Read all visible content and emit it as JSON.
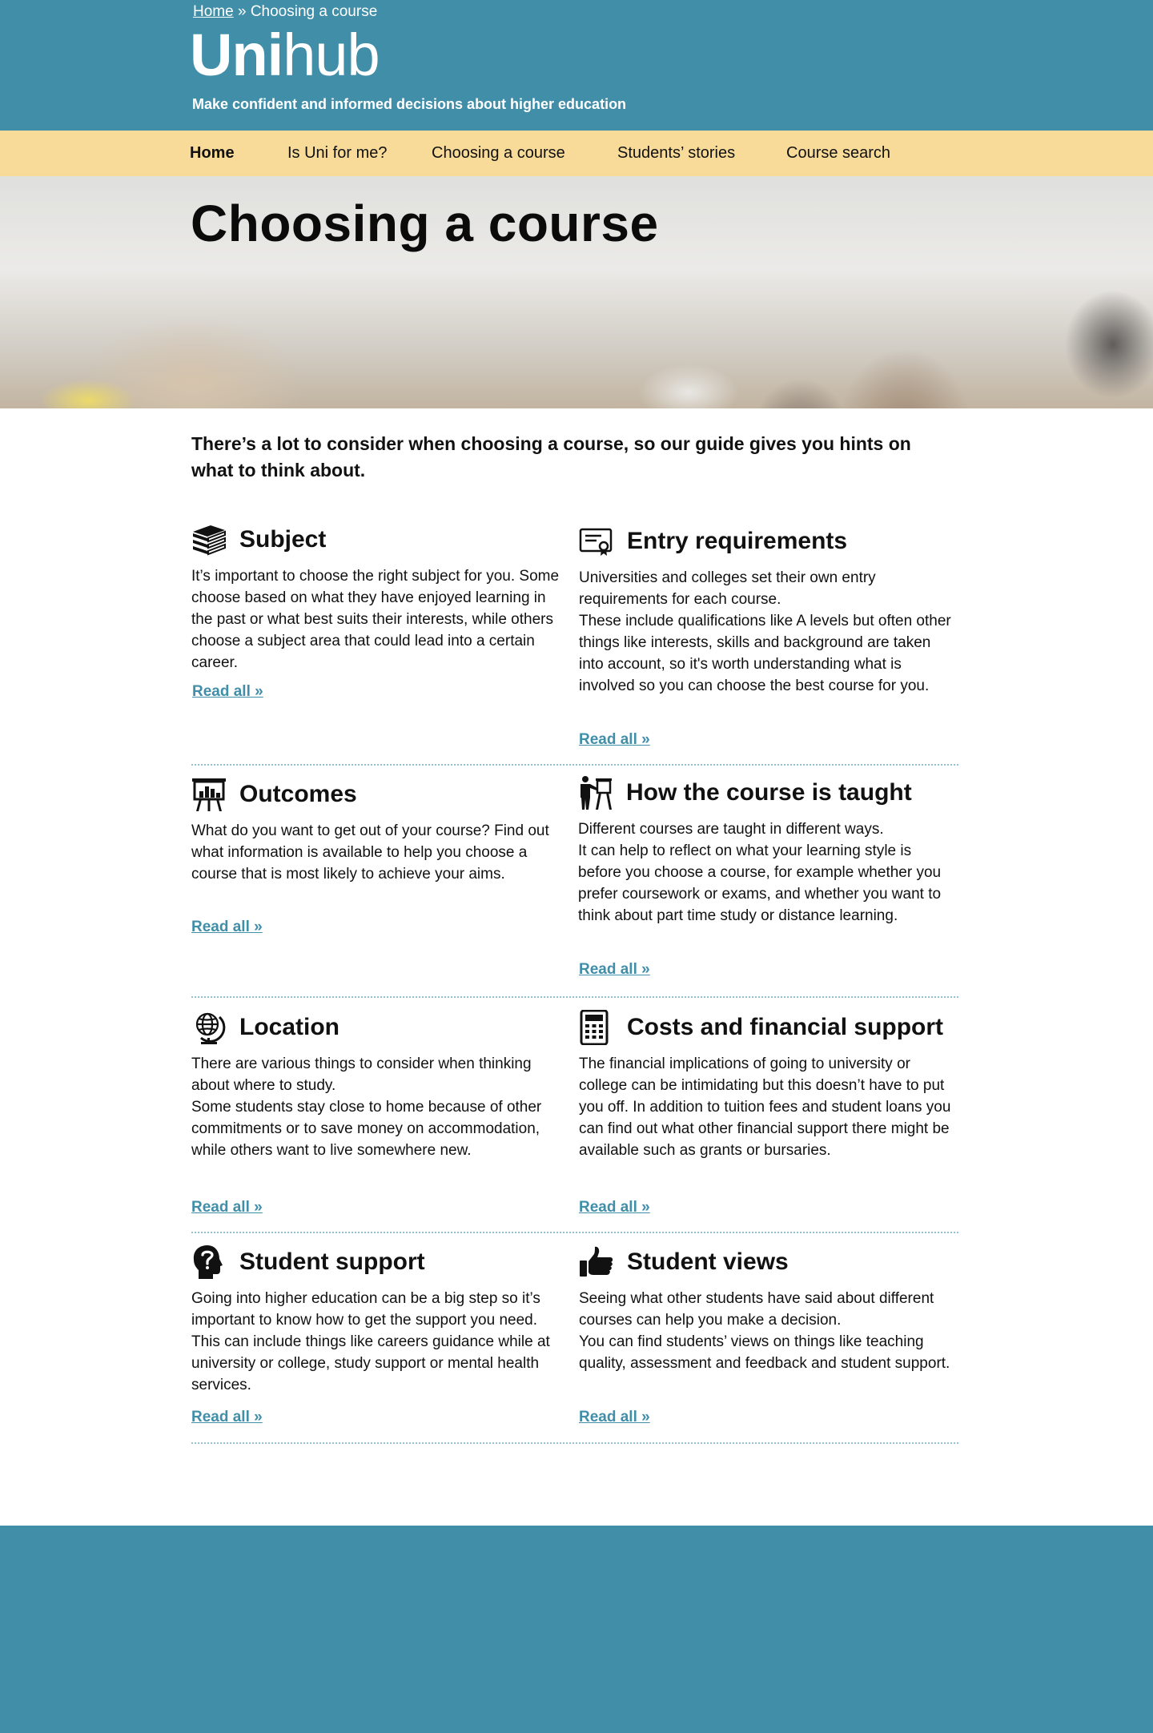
{
  "breadcrumb": {
    "home": "Home",
    "separator": "»",
    "current": "Choosing a course"
  },
  "logo": {
    "bold": "Uni",
    "light": "hub"
  },
  "tagline": "Make confident and informed decisions about higher education",
  "nav": [
    "Home",
    "Is Uni for me?",
    "Choosing a course",
    "Students’ stories",
    "Course search"
  ],
  "hero": {
    "title": "Choosing a course"
  },
  "intro": "There’s a lot to consider when choosing a course, so our guide gives you hints on what to think about.",
  "cards": [
    {
      "title": "Subject",
      "icon": "books-icon",
      "text": "It’s important to choose the right subject for you. Some choose based on what they have enjoyed learning in the past or what best suits their interests, while others choose a subject area that could lead into a certain career.",
      "link": "Read all »"
    },
    {
      "title": "Entry requirements",
      "icon": "certificate-icon",
      "text": "Universities and colleges set their own entry requirements for each course.\nThese include qualifications like A levels but often other things like interests, skills and background are taken into account, so it's worth understanding what is involved so you can choose the best course for you.",
      "link": "Read all »"
    },
    {
      "title": "Outcomes",
      "icon": "presentation-chart-icon",
      "text": "What do you want to get out of your course? Find out what information is available to help you choose a course that is most likely to achieve your aims.",
      "link": "Read all »"
    },
    {
      "title": "How the course is taught",
      "icon": "teacher-icon",
      "text": "Different courses are taught in different ways.\nIt can help to reflect on what your learning style is before you choose a course, for example whether you prefer coursework or exams, and whether you want to think about part time study or distance learning.",
      "link": "Read all »"
    },
    {
      "title": "Location",
      "icon": "globe-icon",
      "text": "There are various things to consider when thinking about where to study.\nSome students stay close to home because of other commitments or to save money on accommodation, while others want to live somewhere new.",
      "link": "Read all »"
    },
    {
      "title": "Costs and financial support",
      "icon": "calculator-icon",
      "text": "The financial implications of going to university or college can be intimidating but this doesn’t have to put you off. In addition to tuition fees and student loans you can find out what other financial support there might be available such as grants or bursaries.",
      "link": "Read all »"
    },
    {
      "title": "Student support",
      "icon": "head-question-icon",
      "text": "Going into higher education can be a big step so it’s important to know how to get the support you need. This can include things like careers guidance while at university or college, study support or mental health services.",
      "link": "Read all »"
    },
    {
      "title": "Student views",
      "icon": "thumbs-up-icon",
      "text": "Seeing what other students have said about different courses can help you make a decision.\nYou can find students’ views on things like teaching quality, assessment and feedback and student support.",
      "link": "Read all »"
    }
  ],
  "colors": {
    "header": "#418ea9",
    "nav": "#f8db98",
    "link": "#418ea9",
    "divider": "#93c4d4"
  }
}
